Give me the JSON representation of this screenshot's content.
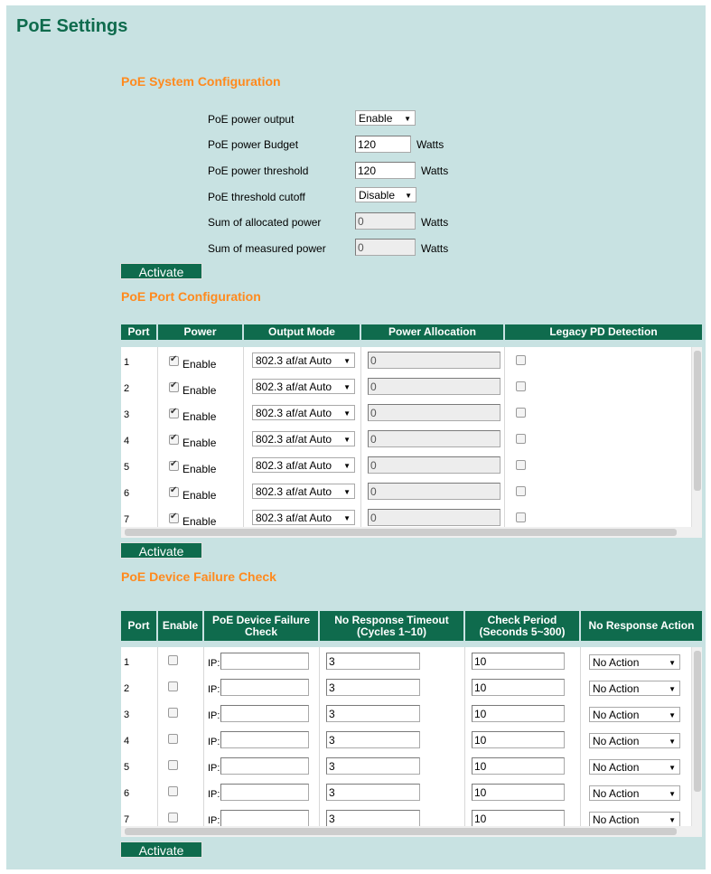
{
  "page_title": "PoE Settings",
  "system": {
    "heading": "PoE System Configuration",
    "power_output_label": "PoE power output",
    "power_output_value": "Enable",
    "budget_label": "PoE power Budget",
    "budget_value": "120",
    "budget_unit": "Watts",
    "threshold_label": "PoE power threshold",
    "threshold_value": "120",
    "threshold_unit": "Watts",
    "cutoff_label": "PoE threshold cutoff",
    "cutoff_value": "Disable",
    "allocated_label": "Sum of allocated power",
    "allocated_value": "0",
    "allocated_unit": "Watts",
    "measured_label": "Sum of measured power",
    "measured_value": "0",
    "measured_unit": "Watts",
    "activate_label": "Activate"
  },
  "port_config": {
    "heading": "PoE Port Configuration",
    "headers": [
      "Port",
      "Power",
      "Output Mode",
      "Power Allocation",
      "Legacy PD Detection"
    ],
    "rows": [
      {
        "port": "1",
        "power_checked": true,
        "power_label": "Enable",
        "output_mode": "802.3 af/at Auto",
        "allocation": "0",
        "legacy_checked": false
      },
      {
        "port": "2",
        "power_checked": true,
        "power_label": "Enable",
        "output_mode": "802.3 af/at Auto",
        "allocation": "0",
        "legacy_checked": false
      },
      {
        "port": "3",
        "power_checked": true,
        "power_label": "Enable",
        "output_mode": "802.3 af/at Auto",
        "allocation": "0",
        "legacy_checked": false
      },
      {
        "port": "4",
        "power_checked": true,
        "power_label": "Enable",
        "output_mode": "802.3 af/at Auto",
        "allocation": "0",
        "legacy_checked": false
      },
      {
        "port": "5",
        "power_checked": true,
        "power_label": "Enable",
        "output_mode": "802.3 af/at Auto",
        "allocation": "0",
        "legacy_checked": false
      },
      {
        "port": "6",
        "power_checked": true,
        "power_label": "Enable",
        "output_mode": "802.3 af/at Auto",
        "allocation": "0",
        "legacy_checked": false
      },
      {
        "port": "7",
        "power_checked": true,
        "power_label": "Enable",
        "output_mode": "802.3 af/at Auto",
        "allocation": "0",
        "legacy_checked": false
      }
    ],
    "activate_label": "Activate"
  },
  "failure_check": {
    "heading": "PoE Device Failure Check",
    "headers": [
      "Port",
      "Enable",
      "PoE Device Failure Check",
      "No Response Timeout (Cycles 1~10)",
      "Check Period (Seconds 5~300)",
      "No Response Action"
    ],
    "rows": [
      {
        "port": "1",
        "enabled": false,
        "ip_label": "IP:",
        "ip": "",
        "timeout": "3",
        "period": "10",
        "action": "No Action"
      },
      {
        "port": "2",
        "enabled": false,
        "ip_label": "IP:",
        "ip": "",
        "timeout": "3",
        "period": "10",
        "action": "No Action"
      },
      {
        "port": "3",
        "enabled": false,
        "ip_label": "IP:",
        "ip": "",
        "timeout": "3",
        "period": "10",
        "action": "No Action"
      },
      {
        "port": "4",
        "enabled": false,
        "ip_label": "IP:",
        "ip": "",
        "timeout": "3",
        "period": "10",
        "action": "No Action"
      },
      {
        "port": "5",
        "enabled": false,
        "ip_label": "IP:",
        "ip": "",
        "timeout": "3",
        "period": "10",
        "action": "No Action"
      },
      {
        "port": "6",
        "enabled": false,
        "ip_label": "IP:",
        "ip": "",
        "timeout": "3",
        "period": "10",
        "action": "No Action"
      },
      {
        "port": "7",
        "enabled": false,
        "ip_label": "IP:",
        "ip": "",
        "timeout": "3",
        "period": "10",
        "action": "No Action"
      }
    ],
    "activate_label": "Activate"
  },
  "icons": {
    "dropdown": "caret-down-icon",
    "checkbox": "checkbox-icon"
  },
  "colors": {
    "header_bg": "#0f6b4d",
    "section_heading": "#ff8a1e",
    "page_bg": "#c8e2e2",
    "title": "#0f6b4d"
  }
}
